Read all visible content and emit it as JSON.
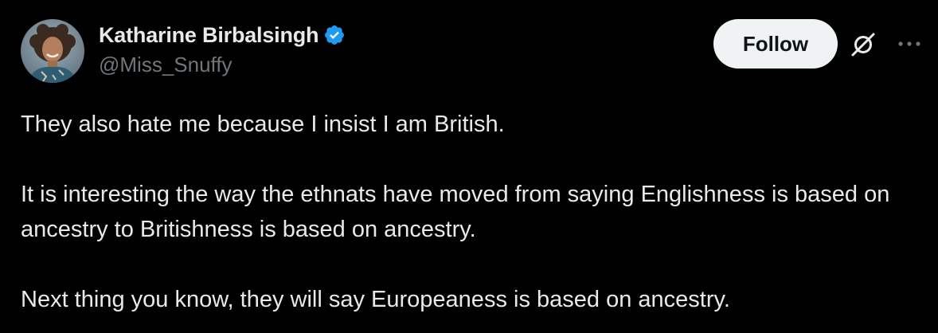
{
  "author": {
    "display_name": "Katharine Birbalsingh",
    "handle": "@Miss_Snuffy",
    "verified": true
  },
  "actions": {
    "follow_label": "Follow"
  },
  "icons": {
    "verified": "verified-badge-icon",
    "grok": "grok-icon",
    "more": "more-options-icon"
  },
  "colors": {
    "background": "#000000",
    "text_primary": "#e7e9ea",
    "text_secondary": "#71767b",
    "verified_blue": "#1d9bf0",
    "follow_bg": "#eff3f4",
    "follow_text": "#0f1419"
  },
  "tweet": {
    "paragraphs": [
      "They also hate me because I insist I am British.",
      "It is interesting the way the ethnats have moved from saying Englishness is based on ancestry to Britishness is based on ancestry.",
      "Next thing you know, they will say Europeaness is based on ancestry."
    ]
  }
}
